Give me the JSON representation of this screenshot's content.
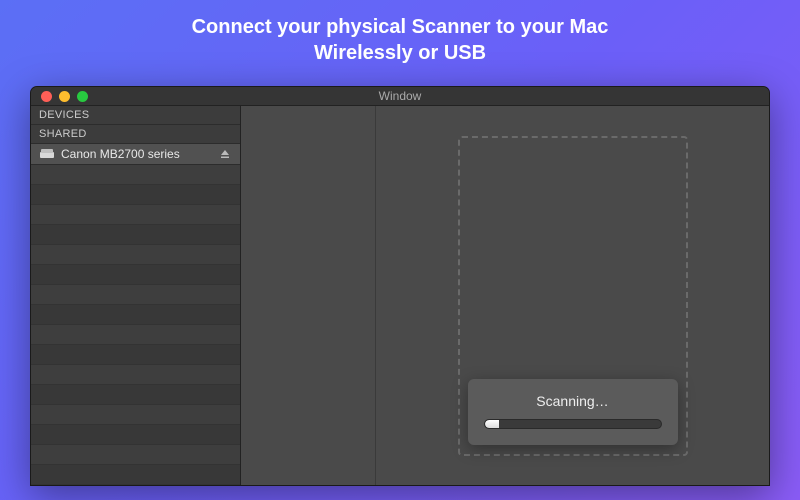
{
  "hero": {
    "line1": "Connect your physical Scanner to your Mac",
    "line2": "Wirelessly or USB"
  },
  "window": {
    "title": "Window"
  },
  "sidebar": {
    "sections": {
      "devices_label": "DEVICES",
      "shared_label": "SHARED"
    },
    "device": {
      "name": "Canon MB2700 series",
      "icon": "scanner-icon",
      "eject_icon": "eject-icon"
    }
  },
  "scan": {
    "status": "Scanning…",
    "progress_percent": 8
  },
  "colors": {
    "bg_gradient_start": "#5b6ff5",
    "bg_gradient_end": "#8a5cf6",
    "window_bg": "#3a3a3a",
    "sidebar_bg": "#3c3c3c",
    "selected_row": "#515151"
  }
}
